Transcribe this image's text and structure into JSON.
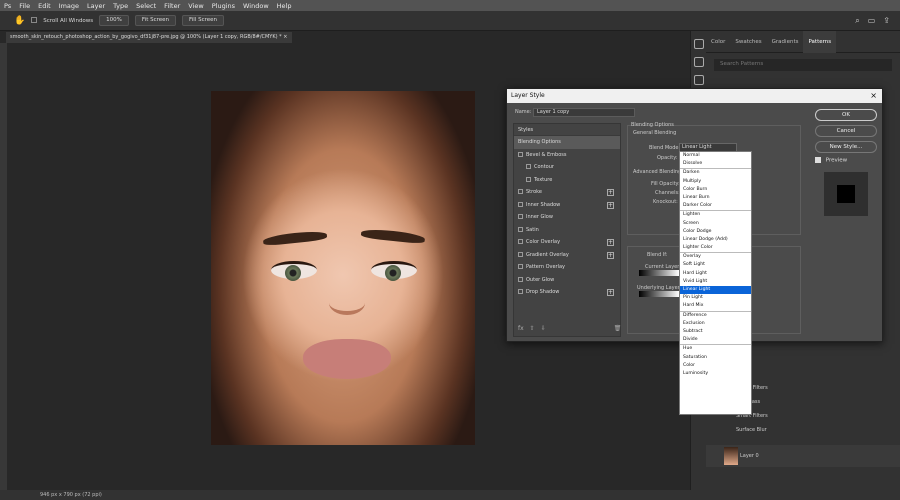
{
  "menu": [
    "File",
    "Edit",
    "Image",
    "Layer",
    "Type",
    "Select",
    "Filter",
    "View",
    "Plugins",
    "Window",
    "Help"
  ],
  "options_bar": {
    "scroll_all_windows": "Scroll All Windows",
    "zoom": "100%",
    "fit_screen": "Fit Screen",
    "fill_screen": "Fill Screen"
  },
  "doc_tab": "smooth_skin_retouch_photoshop_action_by_gogivo_df31j87-pre.jpg @ 100% (Layer 1 copy, RGB/8#/CMYK) *",
  "status": "946 px x 790 px (72 ppi)",
  "panel_tabs": [
    "Color",
    "Swatches",
    "Gradients",
    "Patterns"
  ],
  "panel_search": "Search Patterns",
  "layers": [
    {
      "label": "Smart Filters"
    },
    {
      "label": "High Pass"
    },
    {
      "label": "Smart Filters"
    },
    {
      "label": "Surface Blur"
    },
    {
      "label": "Layer 0"
    }
  ],
  "dialog": {
    "title": "Layer Style",
    "name_label": "Name:",
    "name_value": "Layer 1 copy",
    "styles_header": "Styles",
    "styles": [
      {
        "label": "Blending Options",
        "checkbox": false,
        "selected": true,
        "plus": false
      },
      {
        "label": "Bevel & Emboss",
        "checkbox": true,
        "plus": false
      },
      {
        "label": "Contour",
        "checkbox": true,
        "sub": true,
        "plus": false
      },
      {
        "label": "Texture",
        "checkbox": true,
        "sub": true,
        "plus": false
      },
      {
        "label": "Stroke",
        "checkbox": true,
        "plus": true
      },
      {
        "label": "Inner Shadow",
        "checkbox": true,
        "plus": true
      },
      {
        "label": "Inner Glow",
        "checkbox": true,
        "plus": false
      },
      {
        "label": "Satin",
        "checkbox": true,
        "plus": false
      },
      {
        "label": "Color Overlay",
        "checkbox": true,
        "plus": true
      },
      {
        "label": "Gradient Overlay",
        "checkbox": true,
        "plus": true
      },
      {
        "label": "Pattern Overlay",
        "checkbox": true,
        "plus": false
      },
      {
        "label": "Outer Glow",
        "checkbox": true,
        "plus": false
      },
      {
        "label": "Drop Shadow",
        "checkbox": true,
        "plus": true
      }
    ],
    "blending": {
      "section": "Blending Options",
      "general": "General Blending",
      "blend_mode_label": "Blend Mode:",
      "blend_mode_value": "Linear Light",
      "opacity_label": "Opacity:",
      "advanced": "Advanced Blending",
      "fill_opacity_label": "Fill Opacity:",
      "channels_label": "Channels:",
      "knockout_label": "Knockout:",
      "blend_if_label": "Blend If:",
      "current_layer_label": "Current Layer:",
      "underlying_layer_label": "Underlying Layer:"
    },
    "buttons": {
      "ok": "OK",
      "cancel": "Cancel",
      "new_style": "New Style...",
      "preview": "Preview"
    }
  },
  "blend_modes": [
    [
      "Normal",
      "Dissolve"
    ],
    [
      "Darken",
      "Multiply",
      "Color Burn",
      "Linear Burn",
      "Darker Color"
    ],
    [
      "Lighten",
      "Screen",
      "Color Dodge",
      "Linear Dodge (Add)",
      "Lighter Color"
    ],
    [
      "Overlay",
      "Soft Light",
      "Hard Light",
      "Vivid Light",
      "Linear Light",
      "Pin Light",
      "Hard Mix"
    ],
    [
      "Difference",
      "Exclusion",
      "Subtract",
      "Divide"
    ],
    [
      "Hue",
      "Saturation",
      "Color",
      "Luminosity"
    ]
  ],
  "selected_blend_mode": "Linear Light",
  "colors": {
    "accent_selection": "#0a64d8",
    "dialog_bg": "#4b4b4b"
  }
}
